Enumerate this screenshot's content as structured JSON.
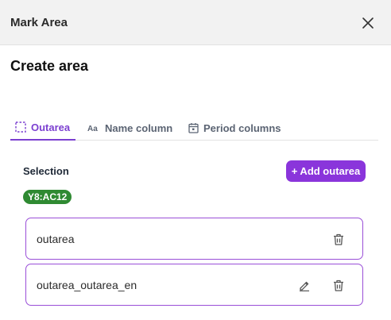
{
  "header": {
    "title": "Mark Area",
    "close_icon": "close-icon"
  },
  "page_title": "Create area",
  "tabs": [
    {
      "label": "Outarea",
      "icon": "dashed-selection-icon",
      "active": true
    },
    {
      "label": "Name column",
      "icon": "text-format-icon",
      "active": false
    },
    {
      "label": "Period columns",
      "icon": "calendar-icon",
      "active": false
    }
  ],
  "selection": {
    "label": "Selection",
    "range": "Y8:AC12"
  },
  "add_button": {
    "label": "+ Add outarea"
  },
  "areas": [
    {
      "name": "outarea",
      "actions": [
        "delete"
      ]
    },
    {
      "name": "outarea_outarea_en",
      "actions": [
        "edit",
        "delete"
      ]
    }
  ],
  "colors": {
    "accent": "#8a35db",
    "badge": "#2f8a32",
    "header_bg": "#f2f2f2"
  }
}
